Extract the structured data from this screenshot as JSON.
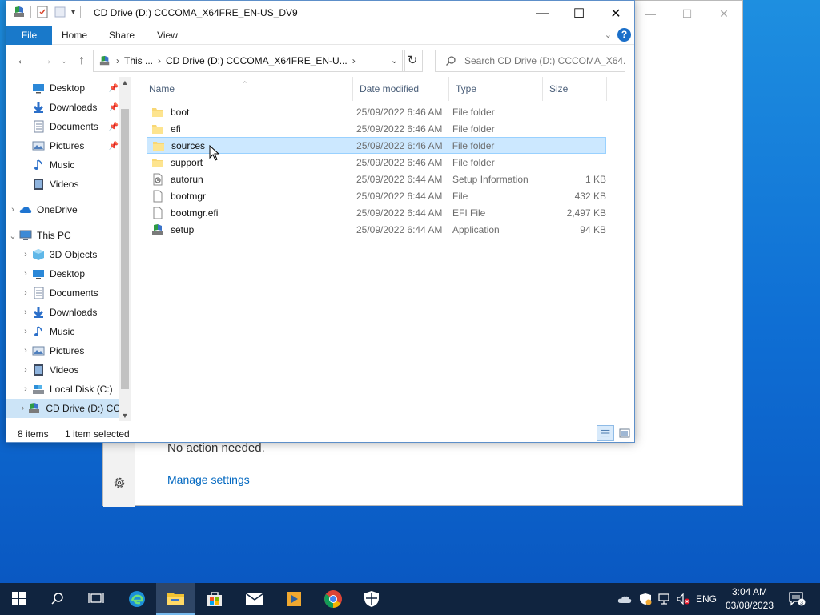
{
  "background_window": {
    "message": "No action needed.",
    "manage_link": "Manage settings"
  },
  "explorer": {
    "title": "CD Drive (D:) CCCOMA_X64FRE_EN-US_DV9",
    "ribbon": {
      "file": "File",
      "home": "Home",
      "share": "Share",
      "view": "View",
      "help": "?"
    },
    "address": {
      "crumb1": "This ...",
      "crumb2": "CD Drive (D:) CCCOMA_X64FRE_EN-U..."
    },
    "search_placeholder": "Search CD Drive (D:) CCCOMA_X64...",
    "columns": {
      "name": "Name",
      "date": "Date modified",
      "type": "Type",
      "size": "Size"
    },
    "files": [
      {
        "name": "boot",
        "date": "25/09/2022 6:46 AM",
        "type": "File folder",
        "size": "",
        "icon": "folder-icon"
      },
      {
        "name": "efi",
        "date": "25/09/2022 6:46 AM",
        "type": "File folder",
        "size": "",
        "icon": "folder-icon"
      },
      {
        "name": "sources",
        "date": "25/09/2022 6:46 AM",
        "type": "File folder",
        "size": "",
        "icon": "folder-icon",
        "selected": true
      },
      {
        "name": "support",
        "date": "25/09/2022 6:46 AM",
        "type": "File folder",
        "size": "",
        "icon": "folder-icon"
      },
      {
        "name": "autorun",
        "date": "25/09/2022 6:44 AM",
        "type": "Setup Information",
        "size": "1 KB",
        "icon": "setup-info-icon"
      },
      {
        "name": "bootmgr",
        "date": "25/09/2022 6:44 AM",
        "type": "File",
        "size": "432 KB",
        "icon": "file-icon"
      },
      {
        "name": "bootmgr.efi",
        "date": "25/09/2022 6:44 AM",
        "type": "EFI File",
        "size": "2,497 KB",
        "icon": "file-icon"
      },
      {
        "name": "setup",
        "date": "25/09/2022 6:44 AM",
        "type": "Application",
        "size": "94 KB",
        "icon": "setup-app-icon"
      }
    ],
    "nav": {
      "quick": [
        {
          "label": "Desktop",
          "icon": "desktop-icon",
          "pinned": true
        },
        {
          "label": "Downloads",
          "icon": "downloads-icon",
          "pinned": true
        },
        {
          "label": "Documents",
          "icon": "documents-icon",
          "pinned": true
        },
        {
          "label": "Pictures",
          "icon": "pictures-icon",
          "pinned": true
        },
        {
          "label": "Music",
          "icon": "music-icon",
          "pinned": false
        },
        {
          "label": "Videos",
          "icon": "videos-icon",
          "pinned": false
        }
      ],
      "onedrive": "OneDrive",
      "thispc": "This PC",
      "pc_children": [
        {
          "label": "3D Objects",
          "icon": "3d-objects-icon"
        },
        {
          "label": "Desktop",
          "icon": "desktop-icon"
        },
        {
          "label": "Documents",
          "icon": "documents-icon"
        },
        {
          "label": "Downloads",
          "icon": "downloads-icon"
        },
        {
          "label": "Music",
          "icon": "music-icon"
        },
        {
          "label": "Pictures",
          "icon": "pictures-icon"
        },
        {
          "label": "Videos",
          "icon": "videos-icon"
        },
        {
          "label": "Local Disk (C:)",
          "icon": "local-disk-icon"
        },
        {
          "label": "CD Drive (D:) CC",
          "icon": "cd-drive-icon",
          "selected": true
        }
      ]
    },
    "status": {
      "count": "8 items",
      "selection": "1 item selected"
    }
  },
  "taskbar": {
    "language": "ENG",
    "time": "3:04 AM",
    "date": "03/08/2023",
    "notification_count": "3"
  },
  "colors": {
    "accent": "#1979ca",
    "selection": "#cce8ff",
    "taskbar": "#10243f"
  }
}
